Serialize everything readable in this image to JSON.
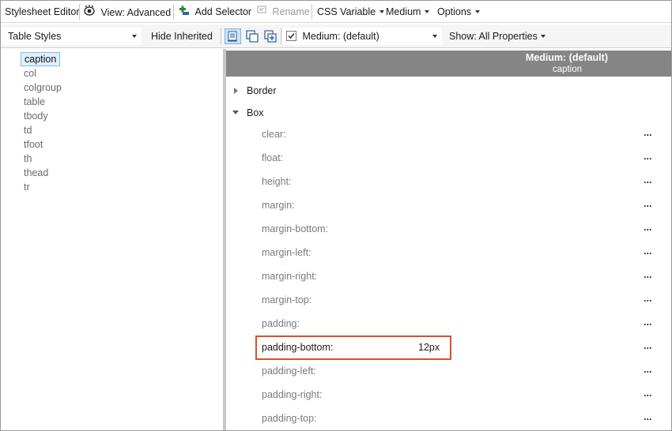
{
  "toolbar": {
    "title": "Stylesheet Editor",
    "view": "View: Advanced",
    "add_selector": "Add Selector",
    "rename": "Rename",
    "css_variable": "CSS Variable",
    "medium": "Medium",
    "options": "Options"
  },
  "toolbar2": {
    "table_styles": "Table Styles",
    "hide_inherited": "Hide Inherited",
    "medium_filter": "Medium: (default)",
    "show": "Show: All Properties"
  },
  "selectors": [
    "caption",
    "col",
    "colgroup",
    "table",
    "tbody",
    "td",
    "tfoot",
    "th",
    "thead",
    "tr"
  ],
  "header": {
    "medium": "Medium: (default)",
    "selector": "caption"
  },
  "groups": {
    "border": "Border",
    "box": "Box"
  },
  "properties": [
    {
      "name": "clear:",
      "value": ""
    },
    {
      "name": "float:",
      "value": ""
    },
    {
      "name": "height:",
      "value": ""
    },
    {
      "name": "margin:",
      "value": ""
    },
    {
      "name": "margin-bottom:",
      "value": ""
    },
    {
      "name": "margin-left:",
      "value": ""
    },
    {
      "name": "margin-right:",
      "value": ""
    },
    {
      "name": "margin-top:",
      "value": ""
    },
    {
      "name": "padding:",
      "value": ""
    },
    {
      "name": "padding-bottom:",
      "value": "12px"
    },
    {
      "name": "padding-left:",
      "value": ""
    },
    {
      "name": "padding-right:",
      "value": ""
    },
    {
      "name": "padding-top:",
      "value": ""
    }
  ],
  "more_label": "...",
  "colors": {
    "header_bg": "#858585",
    "highlight_border": "#d9502a",
    "selected_bg": "#dff0fb"
  }
}
